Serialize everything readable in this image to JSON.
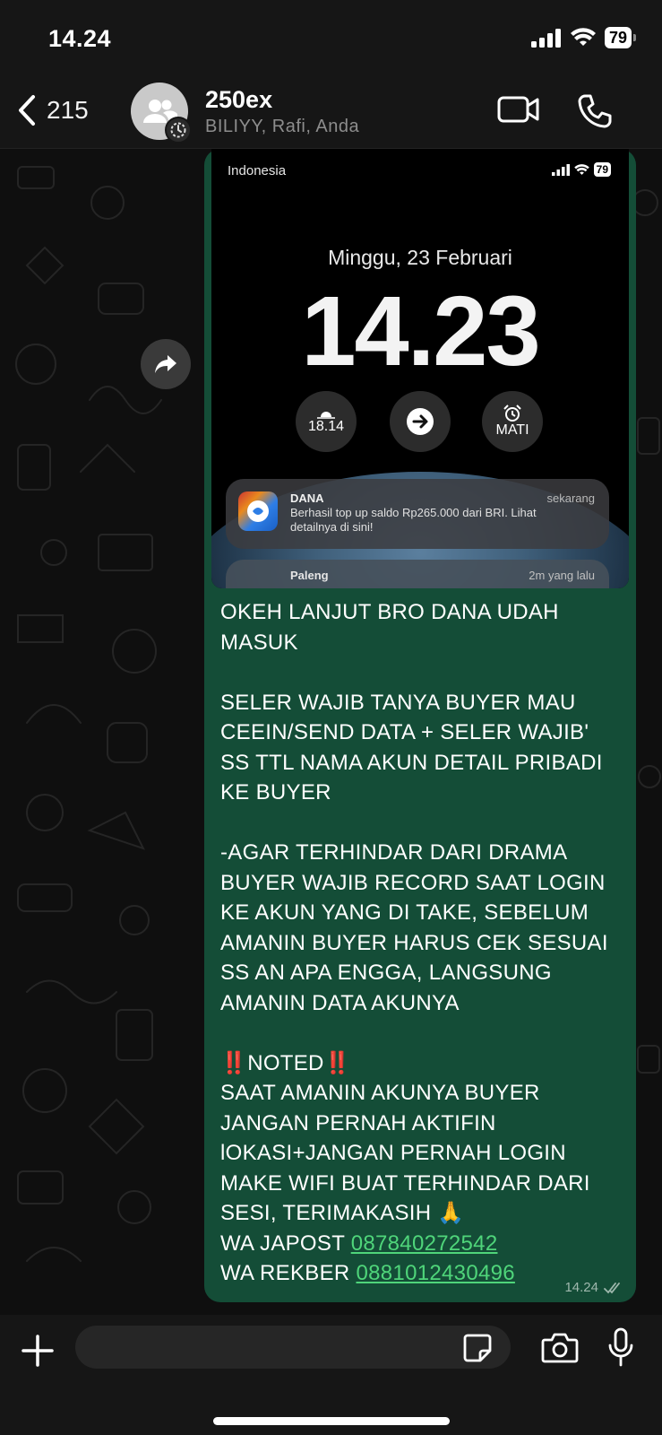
{
  "status_bar": {
    "time": "14.24",
    "battery": "79"
  },
  "header": {
    "back_count": "215",
    "group_name": "250ex",
    "members": "BILIYY, Rafi, Anda"
  },
  "screenshot": {
    "carrier": "Indonesia",
    "battery": "79",
    "date": "Minggu, 23 Februari",
    "time": "14.23",
    "widget_sunset": "18.14",
    "widget_alarm": "MATI",
    "notification": {
      "app": "DANA",
      "when": "sekarang",
      "body": "Berhasil top up saldo Rp265.000 dari BRI. Lihat detailnya di sini!"
    },
    "notification2": {
      "app": "Paleng",
      "when": "2m yang lalu"
    }
  },
  "message": {
    "p1": "OKEH LANJUT BRO DANA UDAH\nMASUK",
    "p2": "SELER WAJIB TANYA BUYER MAU\nCEEIN/SEND DATA + SELER WAJIB'\nSS TTL NAMA AKUN DETAIL PRIBADI\nKE BUYER",
    "p3": "-AGAR TERHINDAR DARI DRAMA\nBUYER WAJIB RECORD SAAT LOGIN\nKE AKUN YANG DI TAKE, SEBELUM\nAMANIN BUYER HARUS CEK SESUAI\nSS AN APA ENGGA, LANGSUNG\nAMANIN DATA AKUNYA",
    "noted_mark": "‼️",
    "noted": "NOTED",
    "p4": "SAAT AMANIN AKUNYA BUYER\nJANGAN PERNAH AKTIFIN\nlOKASI+JANGAN PERNAH LOGIN\nMAKE WIFI BUAT TERHINDAR DARI\nSESI, TERIMAKASIH 🙏",
    "japost_label": "WA JAPOST ",
    "japost_number": "087840272542",
    "rekber_label": "WA REKBER ",
    "rekber_number": "0881012430496",
    "time": "14.24"
  },
  "input": {
    "placeholder": ""
  },
  "colors": {
    "bubble": "#144d37",
    "link": "#4fd57a",
    "header": "#161616"
  }
}
